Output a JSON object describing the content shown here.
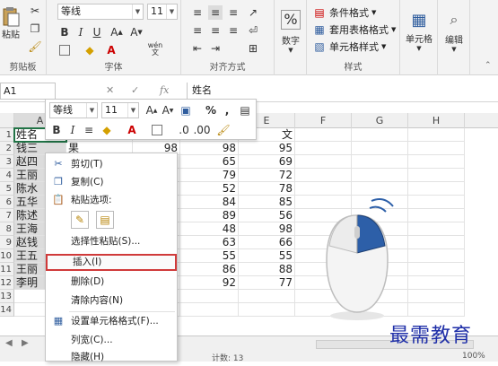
{
  "ribbon": {
    "clipboard": {
      "paste_label": "粘贴",
      "group_label": "剪贴板"
    },
    "font": {
      "family": "等线",
      "size": "11",
      "group_label": "字体",
      "wen": "wén"
    },
    "alignment": {
      "group_label": "对齐方式"
    },
    "number": {
      "label": "数字"
    },
    "styles": {
      "cond_format": "条件格式",
      "table_format": "套用表格格式",
      "cell_style": "单元格样式",
      "group_label": "样式"
    },
    "cells": {
      "label": "单元格"
    },
    "editing": {
      "label": "编辑"
    }
  },
  "formula_bar": {
    "name_box": "A1",
    "content": "姓名",
    "fx": "fx"
  },
  "mini_toolbar": {
    "font": "等线",
    "size": "11",
    "percent": "%",
    "comma": ","
  },
  "columns": [
    "A",
    "B",
    "C",
    "D",
    "E",
    "F",
    "G",
    "H"
  ],
  "rows": [
    {
      "n": "1",
      "a": "姓名",
      "b": "",
      "c": "",
      "d": "",
      "e": "文"
    },
    {
      "n": "2",
      "a": "钱三",
      "b": "果",
      "c": "98",
      "d": "98",
      "e": "95"
    },
    {
      "n": "3",
      "a": "赵四",
      "b": "",
      "c": "58",
      "d": "65",
      "e": "69"
    },
    {
      "n": "4",
      "a": "王丽",
      "b": "",
      "c": "9",
      "d": "79",
      "e": "72"
    },
    {
      "n": "5",
      "a": "陈水",
      "b": "",
      "c": "5",
      "d": "52",
      "e": "78"
    },
    {
      "n": "6",
      "a": "五华",
      "b": "",
      "c": "5",
      "d": "84",
      "e": "85"
    },
    {
      "n": "7",
      "a": "陈述",
      "b": "",
      "c": "6",
      "d": "89",
      "e": "56"
    },
    {
      "n": "8",
      "a": "王海",
      "b": "",
      "c": "3",
      "d": "48",
      "e": "98"
    },
    {
      "n": "9",
      "a": "赵钱",
      "b": "",
      "c": "9",
      "d": "63",
      "e": "66"
    },
    {
      "n": "10",
      "a": "王五",
      "b": "",
      "c": "6",
      "d": "55",
      "e": "55"
    },
    {
      "n": "11",
      "a": "王丽",
      "b": "",
      "c": "2",
      "d": "86",
      "e": "88"
    },
    {
      "n": "12",
      "a": "李明",
      "b": "",
      "c": "5",
      "d": "92",
      "e": "77"
    },
    {
      "n": "13",
      "a": "",
      "b": "",
      "c": "",
      "d": "",
      "e": ""
    },
    {
      "n": "14",
      "a": "",
      "b": "",
      "c": "",
      "d": "",
      "e": ""
    }
  ],
  "context_menu": {
    "cut": "剪切(T)",
    "copy": "复制(C)",
    "paste_options": "粘贴选项:",
    "paste_special": "选择性粘贴(S)...",
    "insert": "插入(I)",
    "delete": "删除(D)",
    "clear": "清除内容(N)",
    "format_cells": "设置单元格格式(F)...",
    "col_width": "列宽(C)...",
    "hide": "隐藏(H)"
  },
  "status": {
    "count": "计数: 13",
    "zoom": "100%"
  },
  "watermark": "最需教育",
  "colors": {
    "accent_red": "#d03a3a",
    "excel_green": "#217346",
    "mouse_blue": "#2d5fa8",
    "watermark": "#1f2fa8"
  }
}
